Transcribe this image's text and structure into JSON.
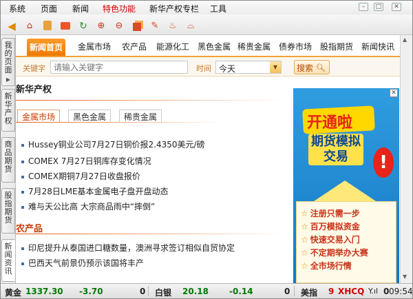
{
  "menu": {
    "items": [
      "系统",
      "页面",
      "新闻",
      "特色功能",
      "新华产权专栏",
      "工具"
    ]
  },
  "window_buttons": [
    "–",
    "□",
    "✕"
  ],
  "toolbar": {
    "icons": [
      "back-arrow-icon",
      "home-icon",
      "notebook-icon",
      "card-icon",
      "refresh-icon",
      "zoom-in-icon",
      "zoom-out-icon",
      "copy-icon",
      "pencil-icon",
      "flame-icon",
      "basket-icon"
    ]
  },
  "left_tabs": [
    "我的页面",
    "新华产权",
    "商品期货",
    "股指期货",
    "新闻资讯"
  ],
  "nav": {
    "items": [
      "新闻首页",
      "金属市场",
      "农产品",
      "能源化工",
      "黑色金属",
      "稀贵金属",
      "债券市场",
      "股指期货",
      "新闻快讯"
    ]
  },
  "search": {
    "keyword_label": "关键字",
    "keyword_placeholder": "请输入关键字",
    "time_label": "时间",
    "time_value": "今天",
    "button_label": "搜索"
  },
  "section1": {
    "title": "新华产权",
    "subtabs": [
      "金属市场",
      "黑色金属",
      "稀贵金属"
    ],
    "news": [
      "Hussey铜业公司7月27日铜价报2.4350美元/磅",
      "COMEX 7月27日铜库存变化情况",
      "COMEX期铜7月27日收盘报价",
      "7月28日LME基本金属电子盘开盘动态",
      "难与天公比高 大宗商品雨中“摔倒”"
    ]
  },
  "section2": {
    "title": "农产品",
    "news": [
      "印尼提升从泰国进口糖数量，澳洲寻求签订相似自贸协定",
      "巴西天气前景仍预示该国将丰产"
    ]
  },
  "ad": {
    "headline": "开通啦",
    "subline1": "期货模拟",
    "subline2": "交易",
    "items": [
      "注册只需一步",
      "百万模拟资金",
      "快速交易入门",
      "不定期举办大赛",
      "全市场行情"
    ]
  },
  "status": {
    "gold_label": "黄金",
    "gold_price": "1337.30",
    "gold_change": "-3.70",
    "gold_count": "0",
    "silver_label": "白银",
    "silver_price": "20.18",
    "silver_change": "-0.14",
    "silver_count": "0",
    "index_label": "美指",
    "index_value": "9",
    "brand": "XHCQ",
    "signal": "Y.ıl",
    "count": "0",
    "time": "09:54"
  },
  "colors": {
    "accent": "#f07a00",
    "up": "#d40000",
    "down": "#007a00",
    "ad_blue": "#1e88d6"
  }
}
